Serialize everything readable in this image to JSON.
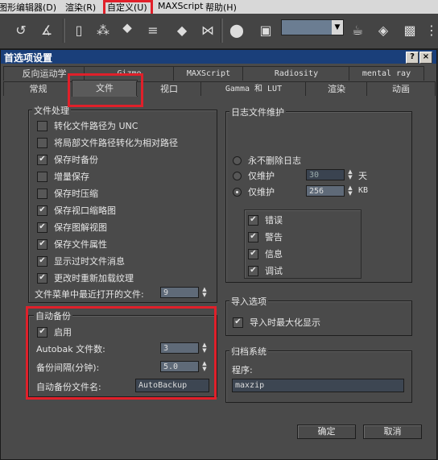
{
  "menu": {
    "items": [
      "图形编辑器(D)",
      "渲染(R)",
      "自定义(U)",
      "MAXScript",
      "帮助(H)"
    ]
  },
  "dialog": {
    "title": "首选项设置",
    "help_btn": "?",
    "close_btn": "×",
    "tabs_row1": [
      "反向运动学",
      "Gizmo",
      "MAXScript",
      "Radiosity",
      "mental ray"
    ],
    "tabs_row2": [
      "常规",
      "文件",
      "视口",
      "Gamma 和 LUT",
      "渲染",
      "动画"
    ],
    "active_tab": "文件"
  },
  "file_handling": {
    "title": "文件处理",
    "items": [
      {
        "label": "转化文件路径为 UNC",
        "checked": false
      },
      {
        "label": "将局部文件路径转化为相对路径",
        "checked": false
      },
      {
        "label": "保存时备份",
        "checked": true
      },
      {
        "label": "增量保存",
        "checked": false
      },
      {
        "label": "保存时压缩",
        "checked": false
      },
      {
        "label": "保存视口缩略图",
        "checked": true
      },
      {
        "label": "保存图解视图",
        "checked": true
      },
      {
        "label": "保存文件属性",
        "checked": true
      },
      {
        "label": "显示过时文件消息",
        "checked": true
      },
      {
        "label": "更改时重新加载纹理",
        "checked": true
      }
    ],
    "recent_label": "文件菜单中最近打开的文件:",
    "recent_value": "9"
  },
  "auto_backup": {
    "title": "自动备份",
    "enable_label": "启用",
    "enabled": true,
    "count_label": "Autobak 文件数:",
    "count_value": "3",
    "interval_label": "备份间隔(分钟):",
    "interval_value": "5.0",
    "filename_label": "自动备份文件名:",
    "filename_value": "AutoBackup"
  },
  "log": {
    "title": "日志文件维护",
    "options": [
      {
        "label": "永不删除日志",
        "selected": false
      },
      {
        "label": "仅维护",
        "selected": false,
        "value": "30",
        "unit": "天"
      },
      {
        "label": "仅维护",
        "selected": true,
        "value": "256",
        "unit": "KB"
      }
    ],
    "checks": [
      {
        "label": "错误",
        "checked": true
      },
      {
        "label": "警告",
        "checked": true
      },
      {
        "label": "信息",
        "checked": true
      },
      {
        "label": "调试",
        "checked": true
      }
    ]
  },
  "import": {
    "title": "导入选项",
    "maximize_label": "导入时最大化显示",
    "checked": true
  },
  "archive": {
    "title": "归档系统",
    "program_label": "程序:",
    "program_value": "maxzip"
  },
  "buttons": {
    "ok": "确定",
    "cancel": "取消"
  }
}
